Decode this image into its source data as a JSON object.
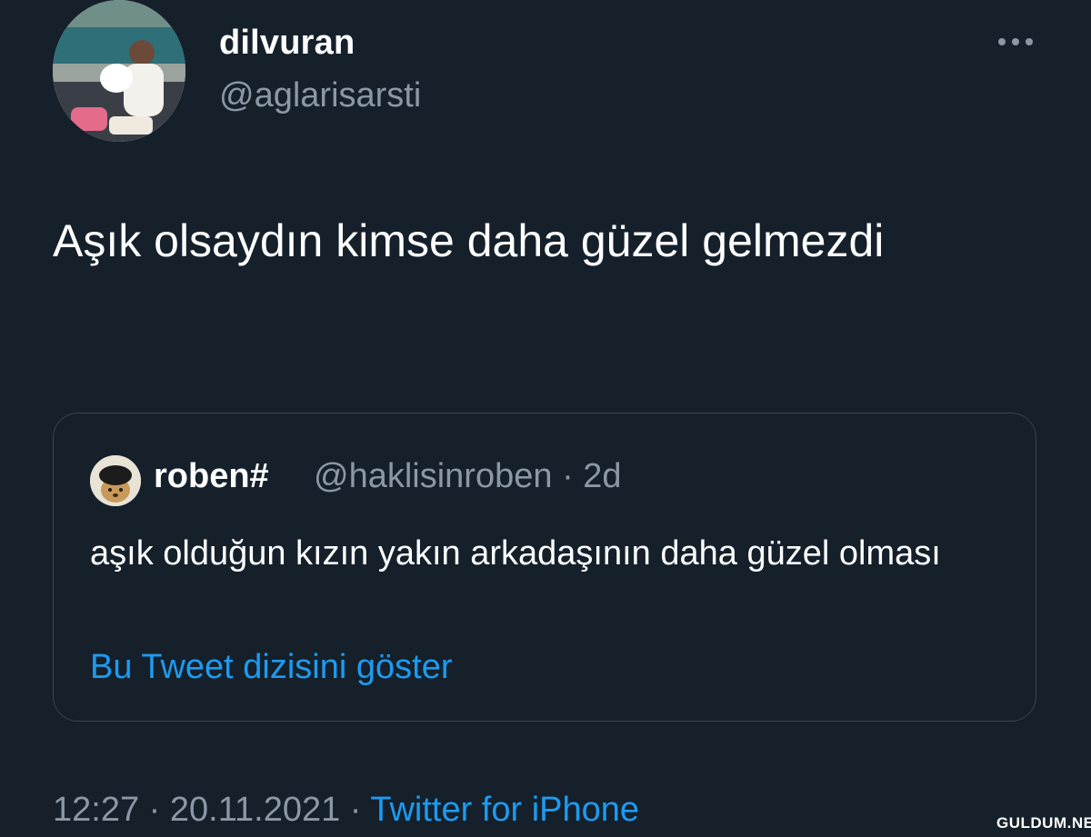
{
  "tweet": {
    "author": {
      "display_name": "dilvuran",
      "handle": "@aglarisarsti"
    },
    "text": "Aşık olsaydın kimse daha güzel gelmezdi",
    "more_icon": "more-horizontal-icon",
    "timestamp": "12:27 · 20.11.2021",
    "separator": " · ",
    "source": "Twitter for iPhone"
  },
  "quote": {
    "author": {
      "display_name": "roben#",
      "handle": "@haklisinroben",
      "time": "· 2d"
    },
    "text": "aşık olduğun kızın yakın arkadaşının daha güzel olması",
    "show_thread_label": "Bu Tweet dizisini göster"
  },
  "watermark": "GULDUM.NET",
  "colors": {
    "background": "#15202b",
    "text_primary": "#ffffff",
    "text_secondary": "#8b98a5",
    "link": "#1d9bf0",
    "border": "#38444d"
  }
}
